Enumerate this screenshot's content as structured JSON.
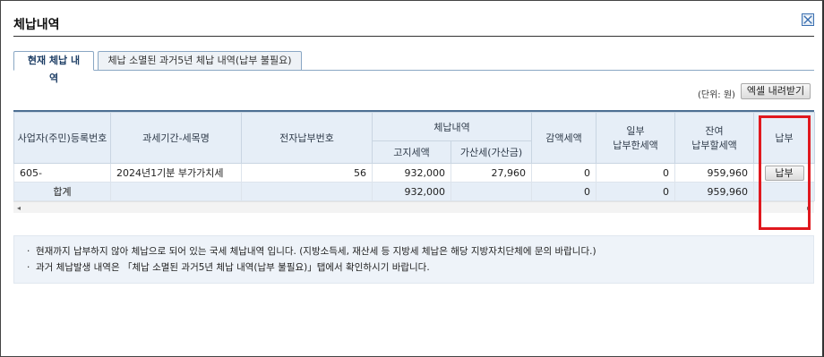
{
  "window": {
    "title": "체납내역",
    "close_icon": "close-icon"
  },
  "tabs": [
    {
      "label": "현재 체납 내역",
      "active": true
    },
    {
      "label": "체납 소멸된 과거5년 체납 내역(납부 불필요)",
      "active": false
    }
  ],
  "toolbar": {
    "unit_label": "(단위: 원)",
    "excel_button": "엑셀 내려받기"
  },
  "table": {
    "headers": {
      "reg_no": "사업자(주민)등록번호",
      "period_item": "과세기간-세목명",
      "elec_pay_no": "전자납부번호",
      "arrears": "체납내역",
      "notice_tax": "고지세액",
      "penalty": "가산세(가산금)",
      "reduced": "감액세액",
      "partial_paid_l1": "일부",
      "partial_paid_l2": "납부한세액",
      "remaining_l1": "잔여",
      "remaining_l2": "납부할세액",
      "pay": "납부"
    },
    "rows": [
      {
        "reg_no": "605-",
        "period_item": "2024년1기분 부가가치세",
        "elec_pay_no": "56",
        "notice_tax": "932,000",
        "penalty": "27,960",
        "reduced": "0",
        "partial_paid": "0",
        "remaining": "959,960",
        "pay_button": "납부"
      }
    ],
    "total": {
      "label": "합계",
      "notice_tax": "932,000",
      "reduced": "0",
      "partial_paid": "0",
      "remaining": "959,960"
    }
  },
  "notice": [
    "현재까지 납부하지 않아 체납으로 되어 있는 국세 체납내역 입니다. (지방소득세, 재산세 등 지방세 체납은 해당 지방자치단체에 문의 바랍니다.)",
    "과거 체납발생 내역은 「체납 소멸된 과거5년 체납 내역(납부 불필요)」탭에서 확인하시기 바랍니다."
  ],
  "colors": {
    "highlight": "#e0181e",
    "header_bg": "#e6eef7",
    "accent": "#4d6f93"
  }
}
